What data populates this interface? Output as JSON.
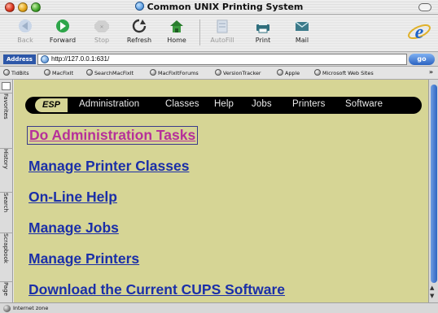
{
  "window": {
    "title": "Common UNIX Printing System"
  },
  "toolbar": {
    "buttons": [
      {
        "label": "Back",
        "enabled": false,
        "icon": "back-arrow-icon"
      },
      {
        "label": "Forward",
        "enabled": true,
        "icon": "forward-arrow-icon"
      },
      {
        "label": "Stop",
        "enabled": false,
        "icon": "stop-icon"
      },
      {
        "label": "Refresh",
        "enabled": true,
        "icon": "refresh-icon"
      },
      {
        "label": "Home",
        "enabled": true,
        "icon": "home-icon"
      },
      {
        "label": "AutoFill",
        "enabled": false,
        "icon": "autofill-icon"
      },
      {
        "label": "Print",
        "enabled": true,
        "icon": "print-icon"
      },
      {
        "label": "Mail",
        "enabled": true,
        "icon": "mail-icon"
      }
    ]
  },
  "address": {
    "label": "Address",
    "url": "http://127.0.0.1:631/",
    "go_label": "go"
  },
  "favorites": {
    "items": [
      "TidBits",
      "MacFixIt",
      "SearchMacFixIt",
      "MacFixItForums",
      "VersionTracker",
      "Apple",
      "Microsoft Web Sites"
    ],
    "overflow": "»"
  },
  "sidetabs": [
    "Favorites",
    "History",
    "Search",
    "Scrapbook",
    "Page"
  ],
  "cups": {
    "logo": "ESP",
    "nav": [
      "Administration",
      "Classes",
      "Help",
      "Jobs",
      "Printers",
      "Software"
    ],
    "links": [
      "Do Administration Tasks",
      "Manage Printer Classes",
      "On-Line Help",
      "Manage Jobs",
      "Manage Printers",
      "Download the Current CUPS Software"
    ]
  },
  "status": {
    "text": "Internet zone"
  },
  "colors": {
    "page_bg": "#d6d595",
    "link": "#1b2fa8",
    "visited_link": "#b6309a",
    "nav_bar": "#000000"
  }
}
